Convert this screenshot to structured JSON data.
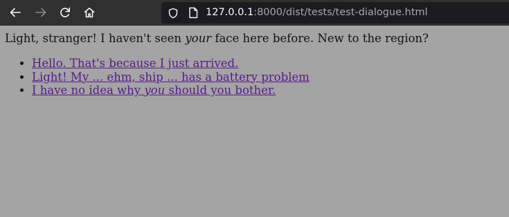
{
  "browser": {
    "url_host": "127.0.0.1",
    "url_rest": ":8000/dist/tests/test-dialogue.html",
    "icons": {
      "back": "arrow-left-icon",
      "forward": "arrow-right-icon",
      "reload": "reload-icon",
      "home": "home-icon",
      "security": "shield-icon",
      "page": "page-icon"
    },
    "colors": {
      "toolbar": "#303030",
      "urlbar": "#1c1b22",
      "url_host": "#fbfbfe",
      "url_rest": "#a8a8b0"
    }
  },
  "dialogue": {
    "prompt_before": "Light, stranger! I haven't seen ",
    "prompt_em": "your",
    "prompt_after": " face here before. New to the region?",
    "choices": [
      {
        "text": "Hello. That's because I just arrived."
      },
      {
        "text": "Light! My ... ehm, ship ... has a battery problem"
      },
      {
        "text_before": "I have no idea why ",
        "text_em": "you",
        "text_after": " should you bother."
      }
    ],
    "colors": {
      "background": "#a4a4a4",
      "link": "#551a8b",
      "text": "#111111"
    }
  }
}
